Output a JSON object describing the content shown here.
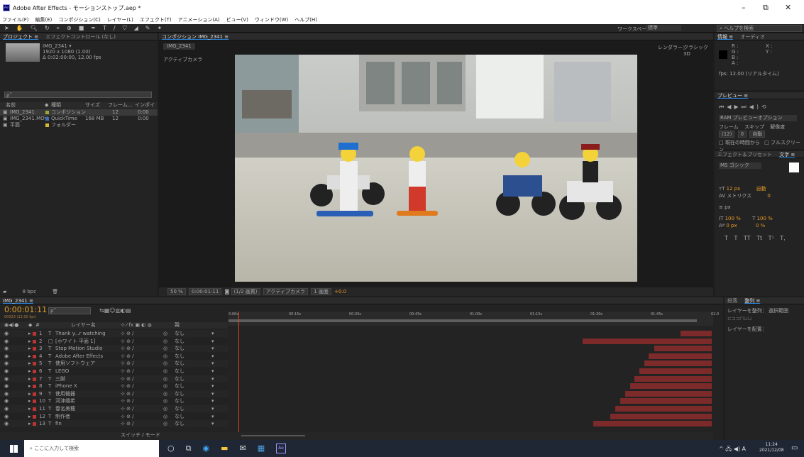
{
  "window": {
    "title": "Adobe After Effects - モーションストップ.aep *",
    "controls": [
      "–",
      "⧉",
      "✕"
    ]
  },
  "menu": [
    "ファイル(F)",
    "編集(E)",
    "コンポジション(C)",
    "レイヤー(L)",
    "エフェクト(T)",
    "アニメーション(A)",
    "ビュー(V)",
    "ウィンドウ(W)",
    "ヘルプ(H)"
  ],
  "toolbar": {
    "workspace_label": "ワークスペース：",
    "workspace_value": "標準",
    "help_search": "ヘルプを検索"
  },
  "project": {
    "tabs": [
      "プロジェクト ≡",
      "エフェクトコントロール (なし)"
    ],
    "item_name": "IMG_2341 ▾",
    "item_res": "1920 x 1080 (1.00)",
    "item_dur": "Δ 0:02:00:00, 12.00 fps",
    "search_placeholder": "ρ˅",
    "columns": [
      "名前",
      "◆",
      "種類",
      "サイズ",
      "フレーム...",
      "インポイ"
    ],
    "items": [
      {
        "name": "IMG_2341",
        "type": "コンポジション",
        "size": "",
        "fps": "12",
        "in": "0:00",
        "color": "#a3a33c"
      },
      {
        "name": "IMG_2341.MOV",
        "type": "QuickTime",
        "size": "168 MB",
        "fps": "12",
        "in": "0:00",
        "color": "#3f6fb0"
      },
      {
        "name": "平面",
        "type": "フォルダー",
        "size": "",
        "fps": "",
        "in": "",
        "color": "#d4b830"
      }
    ],
    "footer": "8 bpc"
  },
  "comp": {
    "tab": "コンポジション IMG_2341 ≡",
    "subtab": "IMG_2341",
    "camera_label": "アクティブカメラ",
    "renderer_label": "レンダラー：",
    "renderer": "クラシック3D",
    "footer": [
      "50 %",
      "0:00:01:11",
      "(1/2 画質)",
      "アクティブカメラ",
      "1 画面",
      "+0.0"
    ]
  },
  "info": {
    "tabs": [
      "情報 ≡",
      "オーディオ"
    ],
    "lines": [
      "R :",
      "G :",
      "B :",
      "A :"
    ],
    "xy": [
      "X :",
      "Y :"
    ],
    "fps": "fps: 12.00 (リアルタイム)"
  },
  "preview": {
    "title": "プレビュー ≡",
    "ram": "RAM プレビューオプション",
    "frame_label": "フレーム",
    "skip_label": "スキップ",
    "res_label": "解像度",
    "frame_val": "(12)",
    "skip_val": "0",
    "res_val": "自動",
    "from_current": "現在の時間から",
    "fullscreen": "フルスクリーン"
  },
  "character": {
    "tabs": [
      "エフェクト＆プリセット",
      "文字 ≡"
    ],
    "font": "MS ゴシック",
    "size": "12 px",
    "leading": "自動",
    "kerning": "メトリクス",
    "tracking": "0",
    "stroke": "px",
    "vscale": "100 %",
    "hscale": "100 %",
    "baseline": "0 px",
    "tsume": "0 %",
    "styles": [
      "T",
      "T",
      "TT",
      "Tt",
      "T¹",
      "T,"
    ]
  },
  "align": {
    "tabs": [
      "段落",
      "整列 ≡"
    ],
    "layer_align": "レイヤーを整列：",
    "target": "選択範囲",
    "distribute": "レイヤーを配置："
  },
  "timeline": {
    "tab": "IMG_2341 ≡",
    "timecode": "0:00:01:11",
    "frames": "00023 (12.00 fps)",
    "search_placeholder": "ρ˅",
    "col_num": "#",
    "col_name": "レイヤー名",
    "col_parent": "親",
    "ruler": [
      "0:00s",
      "00:15s",
      "00:30s",
      "00:45s",
      "01:00s",
      "01:15s",
      "01:30s",
      "01:45s",
      "02:0"
    ],
    "footer_label": "スイッチ / モード",
    "layers": [
      {
        "num": "1",
        "name": "Thank y...r watching",
        "type": "T",
        "color": "#b33",
        "parent": "なし",
        "bar_start": 0.932,
        "fx": false
      },
      {
        "num": "2",
        "name": "[ホワイト 平面 1]",
        "type": "□",
        "color": "#b33",
        "parent": "なし",
        "bar_start": 0.731,
        "fx": true
      },
      {
        "num": "3",
        "name": "Stop Motion Studio",
        "type": "T",
        "color": "#b33",
        "parent": "なし",
        "bar_start": 0.879,
        "fx": false
      },
      {
        "num": "4",
        "name": "Adobe After Effects",
        "type": "T",
        "color": "#b33",
        "parent": "なし",
        "bar_start": 0.867,
        "fx": false
      },
      {
        "num": "5",
        "name": "使用ソフトウェア",
        "type": "T",
        "color": "#b33",
        "parent": "なし",
        "bar_start": 0.858,
        "fx": false
      },
      {
        "num": "6",
        "name": "LEGO",
        "type": "T",
        "color": "#b33",
        "parent": "なし",
        "bar_start": 0.848,
        "fx": false
      },
      {
        "num": "7",
        "name": "三脚",
        "type": "T",
        "color": "#b33",
        "parent": "なし",
        "bar_start": 0.838,
        "fx": false
      },
      {
        "num": "8",
        "name": "iPhone X",
        "type": "T",
        "color": "#b33",
        "parent": "なし",
        "bar_start": 0.828,
        "fx": false
      },
      {
        "num": "9",
        "name": "使用機器",
        "type": "T",
        "color": "#b33",
        "parent": "なし",
        "bar_start": 0.818,
        "fx": false
      },
      {
        "num": "10",
        "name": "河津颯希",
        "type": "T",
        "color": "#b33",
        "parent": "なし",
        "bar_start": 0.808,
        "fx": false
      },
      {
        "num": "11",
        "name": "春名美穂",
        "type": "T",
        "color": "#b33",
        "parent": "なし",
        "bar_start": 0.798,
        "fx": false
      },
      {
        "num": "12",
        "name": "制作者",
        "type": "T",
        "color": "#b33",
        "parent": "なし",
        "bar_start": 0.787,
        "fx": false
      },
      {
        "num": "13",
        "name": "fin",
        "type": "T",
        "color": "#b33",
        "parent": "なし",
        "bar_start": 0.752,
        "fx": false
      }
    ]
  },
  "taskbar": {
    "search_placeholder": "ここに入力して検索",
    "time": "11:24",
    "date": "2021/12/08",
    "ime": "A"
  }
}
